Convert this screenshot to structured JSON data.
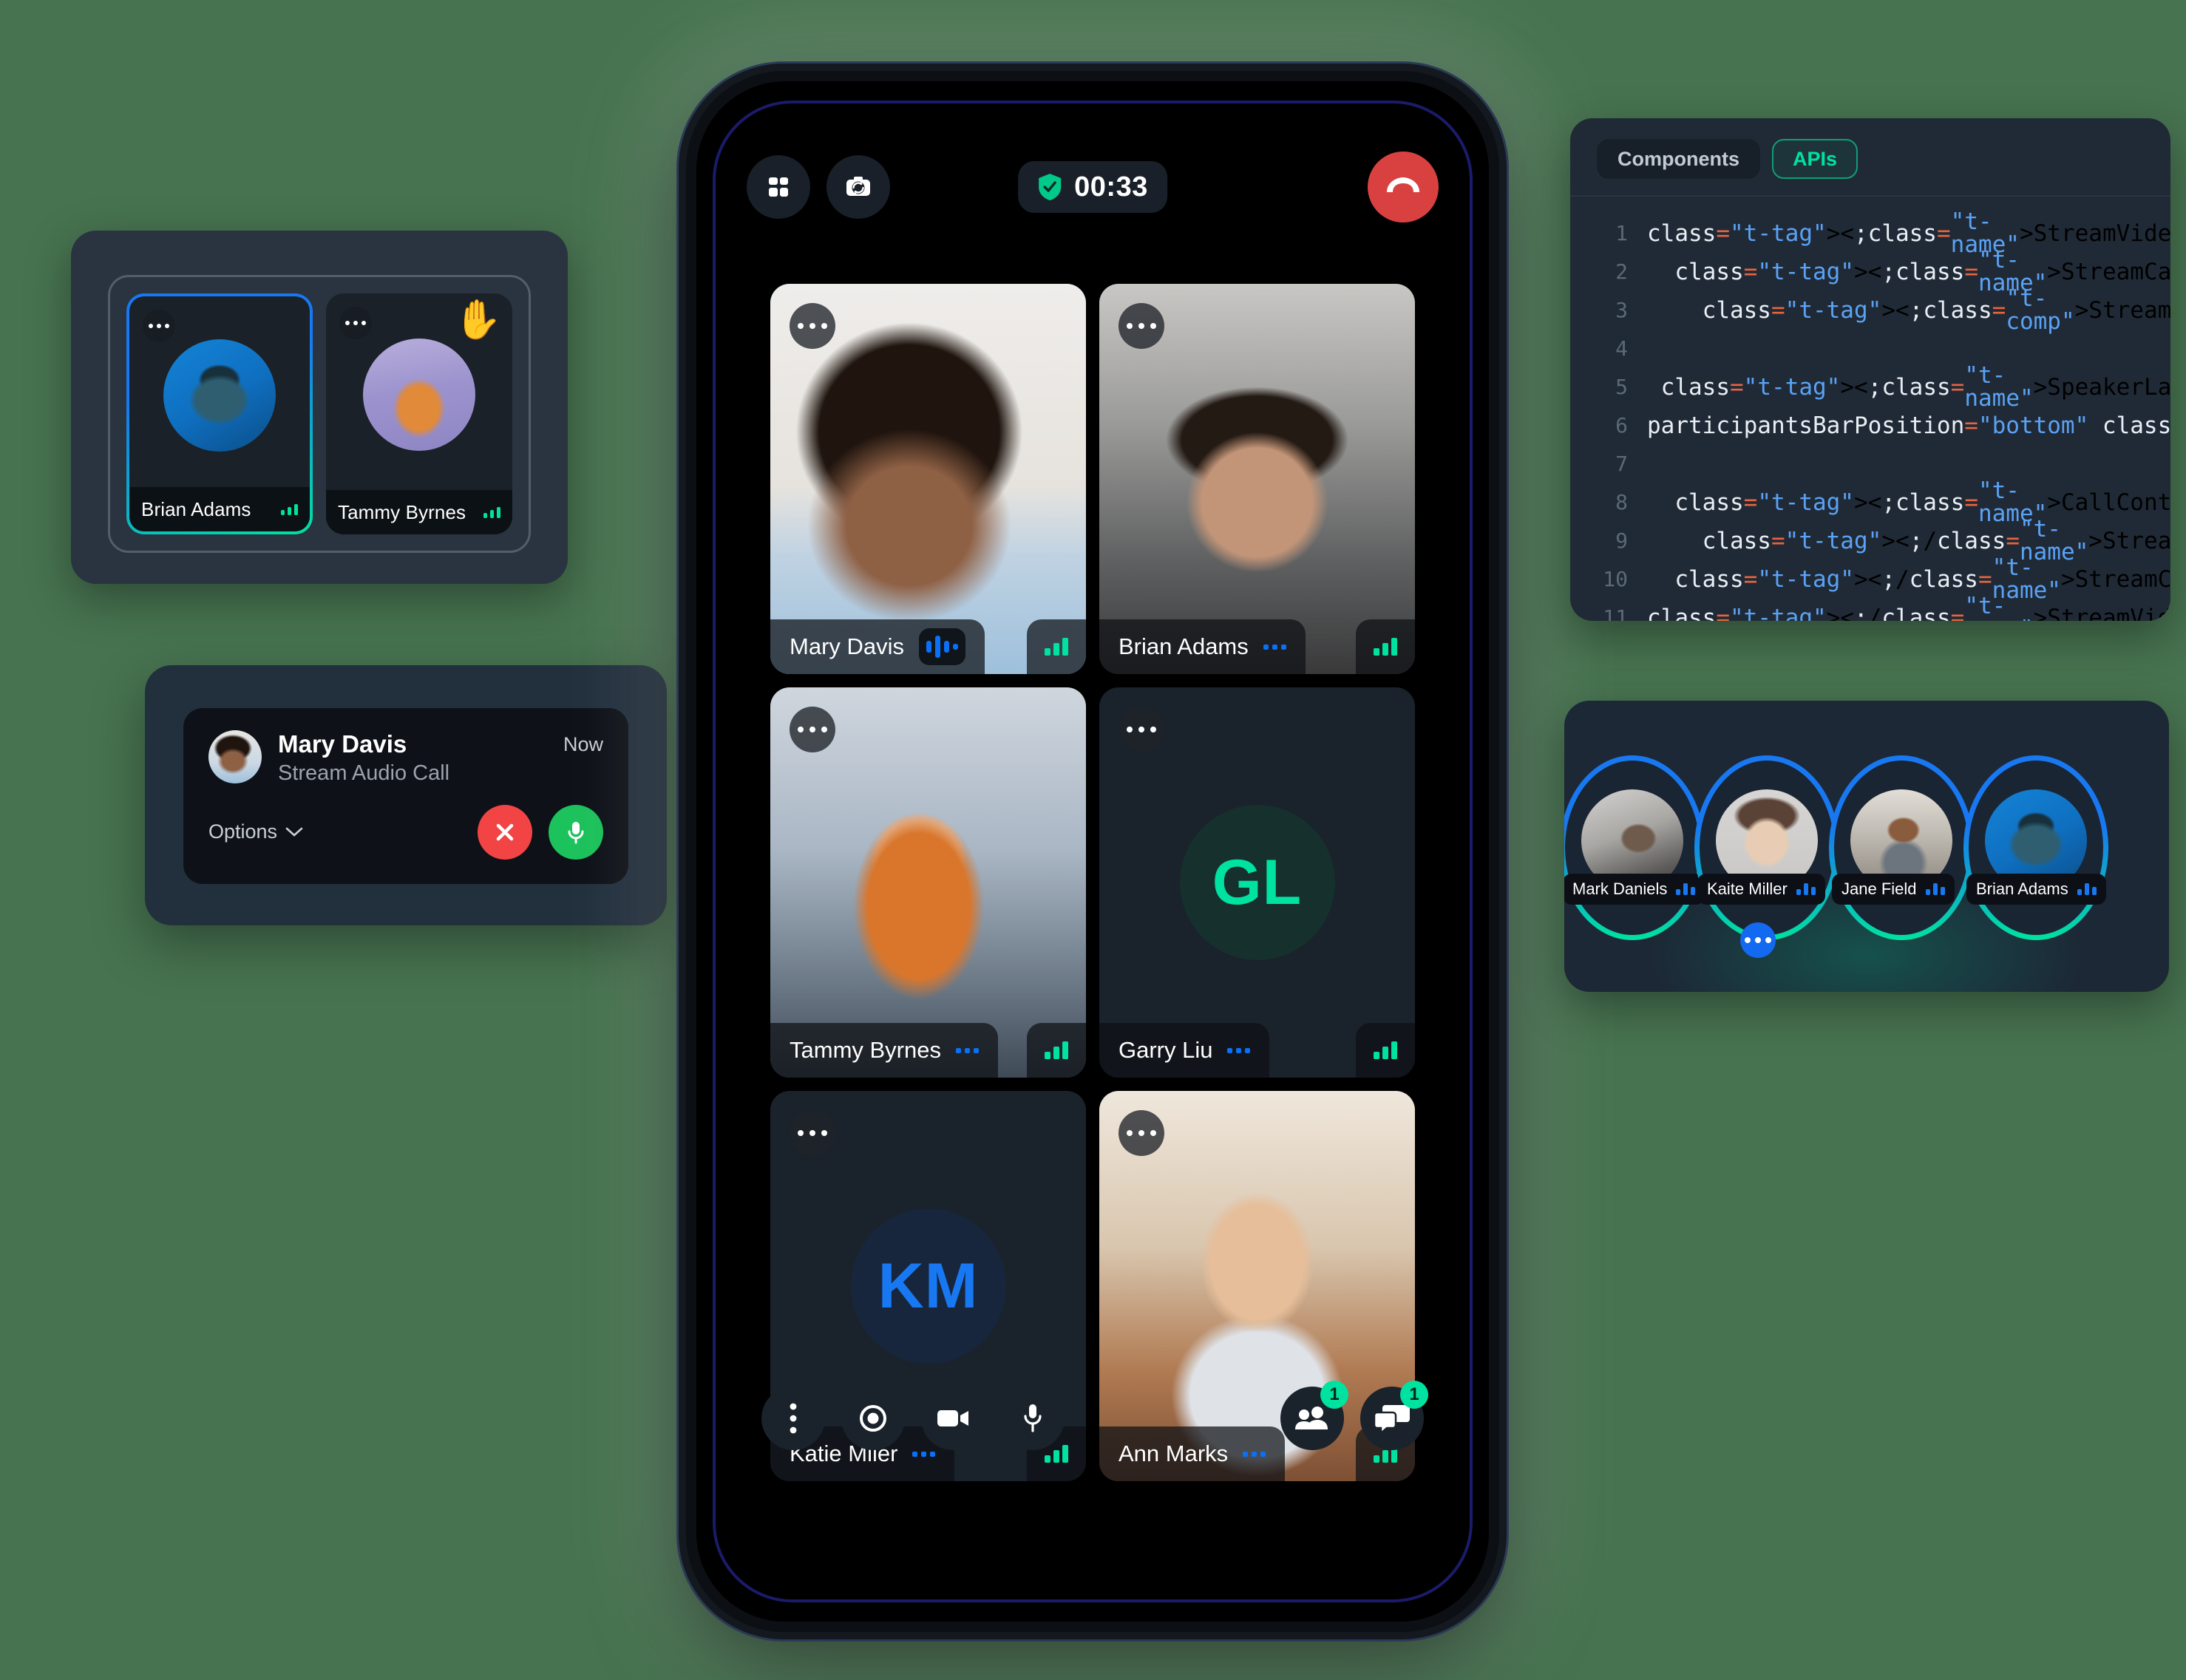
{
  "page": {
    "background_color": "#477350"
  },
  "participants_preview": {
    "tiles": [
      {
        "name": "Brian Adams",
        "active": true,
        "hand_raised": false,
        "more_icon": "more-horizontal-icon",
        "signal_icon": "signal-bars-icon"
      },
      {
        "name": "Tammy Byrnes",
        "active": false,
        "hand_raised": true,
        "hand_emoji": "✋",
        "more_icon": "more-horizontal-icon",
        "signal_icon": "signal-bars-icon"
      }
    ]
  },
  "call_notification": {
    "caller_name": "Mary Davis",
    "subtitle": "Stream Audio Call",
    "time": "Now",
    "options_label": "Options",
    "chevron": "ˇ",
    "decline_label": "✕",
    "accept_icon": "microphone-icon",
    "decline_color": "#F24444",
    "accept_color": "#1CC25B"
  },
  "phone": {
    "topbar": {
      "layout_button": "grid-layout-icon",
      "flip_camera_button": "flip-camera-icon",
      "timer": "00:33",
      "shield_icon": "shield-check-icon",
      "end_call_button": "end-call-icon"
    },
    "participants": [
      {
        "name": "Mary Davis",
        "active": true,
        "media": "video",
        "photo": "ph-mary",
        "speaking": true,
        "more_icon": "more-horizontal-icon",
        "signal_icon": "signal-bars-icon"
      },
      {
        "name": "Brian Adams",
        "active": false,
        "media": "video",
        "photo": "ph-brian",
        "speaking": false,
        "more_icon": "more-horizontal-icon",
        "signal_icon": "signal-bars-icon"
      },
      {
        "name": "Tammy Byrnes",
        "active": false,
        "media": "video",
        "photo": "ph-tammy",
        "speaking": false,
        "more_icon": "more-horizontal-icon",
        "signal_icon": "signal-bars-icon"
      },
      {
        "name": "Garry Liu",
        "active": false,
        "media": "initials",
        "initials": "GL",
        "avatar_bg": "#16302E",
        "avatar_fg": "#00E2A0",
        "speaking": false,
        "more_icon": "more-horizontal-icon",
        "signal_icon": "signal-bars-icon"
      },
      {
        "name": "Katie Miler",
        "active": false,
        "media": "initials",
        "initials": "KM",
        "avatar_bg": "#17263C",
        "avatar_fg": "#1878F2",
        "speaking": false,
        "more_icon": "more-horizontal-icon",
        "signal_icon": "signal-bars-icon"
      },
      {
        "name": "Ann Marks",
        "active": false,
        "media": "video",
        "photo": "ph-ann",
        "speaking": false,
        "more_icon": "more-horizontal-icon",
        "signal_icon": "signal-bars-icon"
      }
    ],
    "controls": {
      "more_button": "more-vertical-icon",
      "record_button": "record-icon",
      "video_button": "video-camera-icon",
      "mic_button": "microphone-icon",
      "participants_button": "participants-icon",
      "participants_badge": "1",
      "chat_button": "chat-bubbles-icon",
      "chat_badge": "1"
    }
  },
  "code_panel": {
    "tabs": [
      {
        "label": "Components",
        "active": false
      },
      {
        "label": "APIs",
        "active": true
      }
    ],
    "lines": [
      {
        "n": "1",
        "text": "<StreamVideo client={client}>"
      },
      {
        "n": "2",
        "text": "  <StreamCall call={call}>"
      },
      {
        "n": "3",
        "text": "    <StreamTheme>"
      },
      {
        "n": "4",
        "text": ""
      },
      {
        "n": "5",
        "text": " <SpeakerLayout"
      },
      {
        "n": "6",
        "text": "participantsBarPosition=\"bottom\" />"
      },
      {
        "n": "7",
        "text": ""
      },
      {
        "n": "8",
        "text": "  <CallControls />"
      },
      {
        "n": "9",
        "text": "    </StreamTheme>"
      },
      {
        "n": "10",
        "text": "  </StreamCall>"
      },
      {
        "n": "11",
        "text": "</StreamVideo>;"
      }
    ]
  },
  "avatar_ring_strip": {
    "items": [
      {
        "name": "Mark Daniels",
        "photo": "ph-mark",
        "mic_icon": "mic-level-icon"
      },
      {
        "name": "Kaite Miller",
        "photo": "ph-kaite",
        "mic_icon": "mic-level-icon"
      },
      {
        "name": "Jane Field",
        "photo": "ph-jane",
        "mic_icon": "mic-level-icon"
      },
      {
        "name": "Brian Adams",
        "photo": "ph-brian-av",
        "mic_icon": "mic-level-icon"
      }
    ],
    "more_button": "more-horizontal-icon"
  },
  "colors": {
    "accent_blue": "#0A70F5",
    "accent_green": "#00E2A0",
    "danger_red": "#D94141",
    "panel_dark": "#1C2836",
    "code_bg": "#202A36"
  }
}
